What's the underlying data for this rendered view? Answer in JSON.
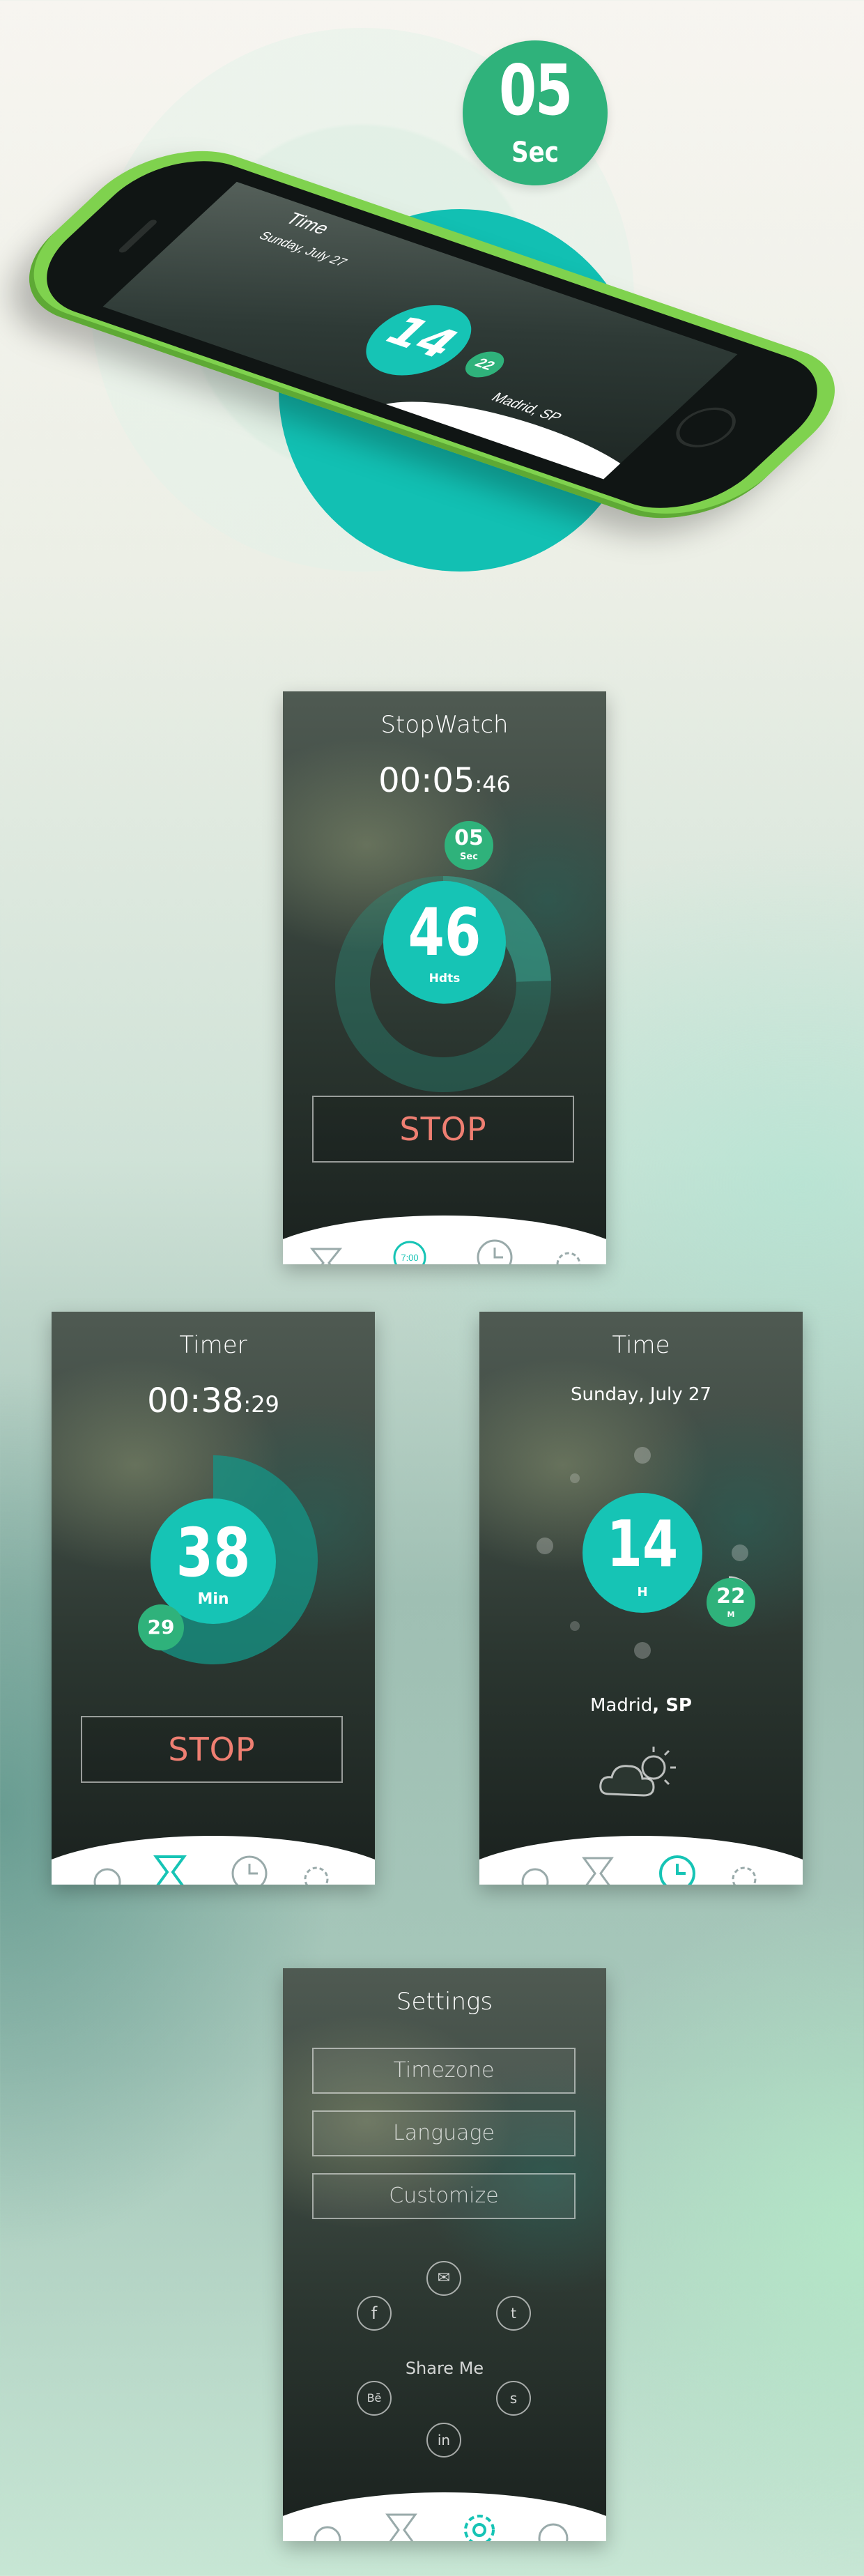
{
  "colors": {
    "teal": "#16c4b5",
    "green": "#2fb27b",
    "stop_text": "#ef7f72",
    "phone_body": "#7fd24e"
  },
  "hero": {
    "badge_value": "05",
    "badge_unit": "Sec",
    "phone_screen": {
      "title": "Time",
      "date": "Sunday, July 27",
      "hour": "14",
      "minute": "22",
      "city": "Madrid, SP"
    }
  },
  "stopwatch": {
    "title": "StopWatch",
    "time_main": "00:05",
    "time_small": ":46",
    "seconds_value": "05",
    "seconds_unit": "Sec",
    "hundredths_value": "46",
    "hundredths_unit": "Hdts",
    "stop_label": "STOP",
    "tabs": [
      "stopwatch-icon",
      "hourglass-icon",
      "clock-icon",
      "gear-icon"
    ],
    "active_tab_label": "7:00"
  },
  "timer": {
    "title": "Timer",
    "time_main": "00:38",
    "time_small": ":29",
    "minutes_value": "38",
    "minutes_unit": "Min",
    "seconds_value": "29",
    "stop_label": "STOP",
    "progress_fraction": 0.62
  },
  "time": {
    "title": "Time",
    "date": "Sunday, July 27",
    "hour_value": "14",
    "hour_unit": "H",
    "minute_value": "22",
    "minute_unit": "M",
    "city": "Madrid",
    "region": ", SP",
    "weather_icon": "cloud-sun-icon"
  },
  "settings": {
    "title": "Settings",
    "buttons": [
      "Timezone",
      "Language",
      "Customize"
    ],
    "share_label": "Share Me",
    "share_icons": [
      "mail-icon",
      "twitter-icon",
      "skype-icon",
      "linkedin-icon",
      "behance-icon",
      "facebook-icon"
    ],
    "share_glyphs": [
      "✉",
      "t",
      "s",
      "in",
      "Bē",
      "f"
    ]
  }
}
